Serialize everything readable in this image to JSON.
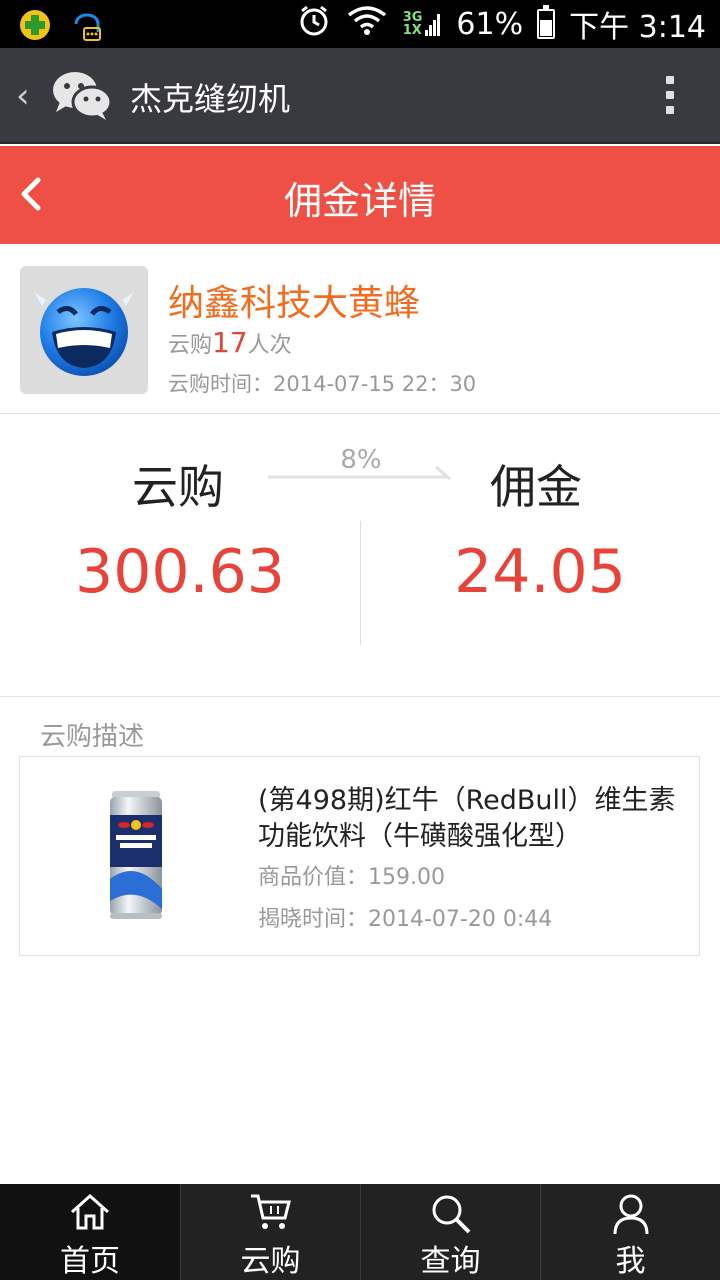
{
  "status_bar": {
    "network_label": "3G",
    "network_label2": "1X",
    "battery": "61%",
    "time": "下午 3:14"
  },
  "wechat_header": {
    "title": "杰克缝纫机"
  },
  "page_header": {
    "title": "佣金详情"
  },
  "user": {
    "name": "纳鑫科技大黄蜂",
    "count_prefix": "云购",
    "count": "17",
    "count_suffix": "人次",
    "time": "云购时间：2014-07-15 22：30"
  },
  "commission": {
    "left_label": "云购",
    "right_label": "佣金",
    "rate": "8%",
    "left_value": "300.63",
    "right_value": "24.05"
  },
  "description": {
    "label": "云购描述",
    "product_title": "(第498期)红牛（RedBull）维生素功能饮料（牛磺酸强化型）",
    "price": "商品价值：159.00",
    "reveal_time": "揭晓时间：2014-07-20  0:44"
  },
  "bottom_nav": [
    {
      "label": "首页",
      "icon": "home-icon"
    },
    {
      "label": "云购",
      "icon": "cart-icon"
    },
    {
      "label": "查询",
      "icon": "search-icon"
    },
    {
      "label": "我",
      "icon": "user-icon"
    }
  ],
  "colors": {
    "accent_red": "#ef5045",
    "value_red": "#e8433a",
    "name_orange": "#f26b1f"
  }
}
